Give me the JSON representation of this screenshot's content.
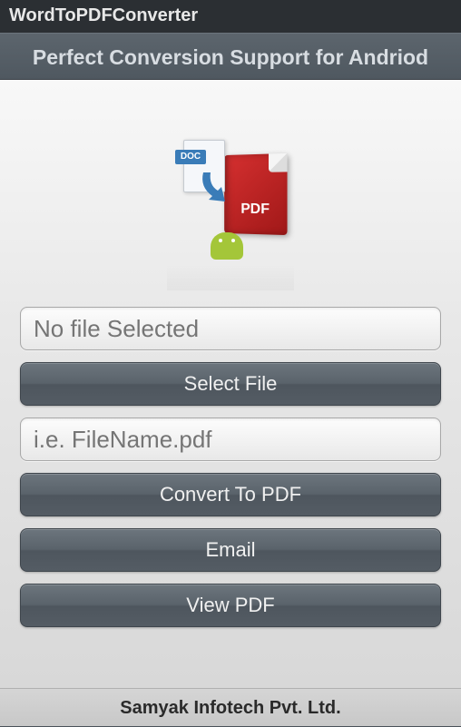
{
  "statusBar": {
    "title": "WordToPDFConverter"
  },
  "header": {
    "tagline": "Perfect Conversion Support for Andriod"
  },
  "logo": {
    "docLabel": "DOC",
    "pdfLabel": "PDF"
  },
  "inputs": {
    "selectedFile": {
      "value": "",
      "placeholder": "No file Selected"
    },
    "outputName": {
      "value": "",
      "placeholder": "i.e. FileName.pdf"
    }
  },
  "buttons": {
    "selectFile": "Select File",
    "convert": "Convert To PDF",
    "email": "Email",
    "viewPdf": "View PDF"
  },
  "footer": {
    "company": "Samyak Infotech Pvt. Ltd."
  }
}
